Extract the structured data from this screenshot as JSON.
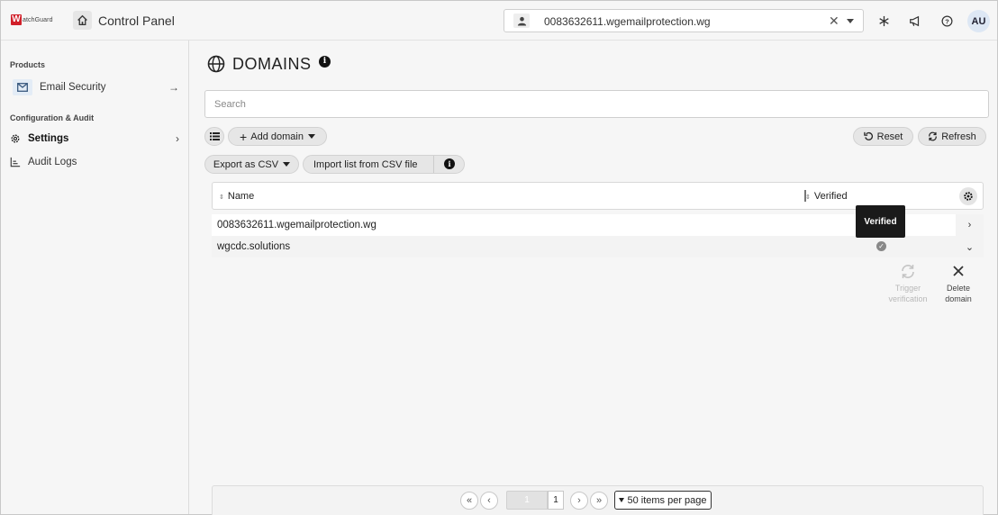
{
  "header": {
    "logo_initial": "W",
    "logo_text": "atchGuard",
    "app_title": "Control Panel",
    "account": "0083632611.wgemailprotection.wg",
    "clear_symbol": "✕",
    "avatar_initials": "AU",
    "icons": [
      "home-icon",
      "user-icon",
      "snowflake-icon",
      "megaphone-icon",
      "help-icon"
    ]
  },
  "sidebar": {
    "products_heading": "Products",
    "email_security": "Email Security",
    "config_heading": "Configuration & Audit",
    "settings": "Settings",
    "audit_logs": "Audit Logs"
  },
  "main": {
    "title": "DOMAINS",
    "info_glyph": "i",
    "search_placeholder": "Search",
    "add_domain": "Add domain",
    "reset": "Reset",
    "refresh": "Refresh",
    "export_csv": "Export as CSV",
    "import_csv": "Import list from CSV file"
  },
  "table": {
    "col_name": "Name",
    "col_verified": "Verified",
    "rows": [
      {
        "name": "0083632611.wgemailprotection.wg",
        "verified": false
      },
      {
        "name": "wgcdc.solutions",
        "verified": true
      }
    ],
    "tooltip": "Verified",
    "trigger_verification": "Trigger verification",
    "delete_domain": "Delete domain"
  },
  "pagination": {
    "current_page": "1",
    "total_pages": "1",
    "per_page": "50 items per page",
    "first": "«",
    "prev": "‹",
    "next": "›",
    "last": "»"
  },
  "colors": {
    "brand_red": "#d1202a",
    "tooltip_bg": "#1a1a1a"
  }
}
